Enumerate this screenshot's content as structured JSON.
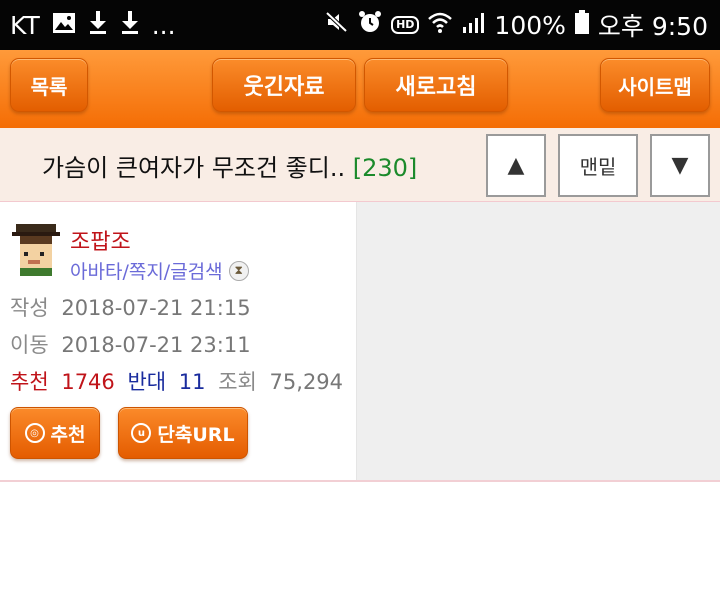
{
  "status_bar": {
    "carrier": "KT",
    "overflow": "...",
    "battery": "100%",
    "time": "오후 9:50",
    "hd_badge": "HD"
  },
  "nav": {
    "list_label": "목록",
    "humor_label": "웃긴자료",
    "refresh_label": "새로고침",
    "sitemap_label": "사이트맵"
  },
  "post": {
    "title": "가슴이 큰여자가 무조건 좋디..",
    "comment_count": "[230]",
    "up_symbol": "▲",
    "bottom_label": "맨밑",
    "down_symbol": "▼"
  },
  "author": {
    "nickname": "조팝조",
    "links": "아바타/쪽지/글검색"
  },
  "meta": {
    "written_label": "작성",
    "written_value": "2018-07-21 21:15",
    "moved_label": "이동",
    "moved_value": "2018-07-21 23:11",
    "recommend_label": "추천",
    "recommend_value": "1746",
    "oppose_label": "반대",
    "oppose_value": "11",
    "views_label": "조회",
    "views_value": "75,294"
  },
  "actions": {
    "recommend_button": "추천",
    "short_url_button": "단축URL"
  },
  "colors": {
    "accent": "#f46d05",
    "recommend": "#c0141a",
    "oppose": "#1a2c9e",
    "comment_count": "#1b8a2b"
  }
}
